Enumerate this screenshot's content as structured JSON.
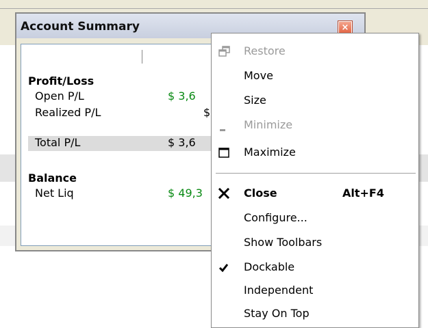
{
  "window": {
    "title": "Account Summary",
    "close_glyph": "×"
  },
  "profit_loss": {
    "heading": "Profit/Loss",
    "rows": [
      {
        "label": "Open P/L",
        "value": "$ 3,6"
      },
      {
        "label": "Realized P/L",
        "value": "$"
      },
      {
        "label": "Total P/L",
        "value": "$ 3,6"
      }
    ]
  },
  "balance": {
    "heading": "Balance",
    "rows": [
      {
        "label": "Net Liq",
        "value": "$ 49,3"
      }
    ]
  },
  "context_menu": {
    "items": [
      {
        "label": "Restore",
        "icon": "restore-icon",
        "disabled": true
      },
      {
        "label": "Move"
      },
      {
        "label": "Size"
      },
      {
        "label": "Minimize",
        "icon": "minimize-icon",
        "disabled": true
      },
      {
        "label": "Maximize",
        "icon": "maximize-icon"
      },
      {
        "label": "Close",
        "icon": "close-icon",
        "shortcut": "Alt+F4",
        "bold": true
      },
      {
        "label": "Configure..."
      },
      {
        "label": "Show Toolbars"
      },
      {
        "label": "Dockable",
        "icon": "checkmark-icon",
        "checked": true
      },
      {
        "label": "Independent"
      },
      {
        "label": "Stay On Top"
      }
    ]
  },
  "colors": {
    "positive_value": "#0a8a14",
    "disabled_text": "#9a9a9a",
    "window_bg": "#ece9d8"
  }
}
